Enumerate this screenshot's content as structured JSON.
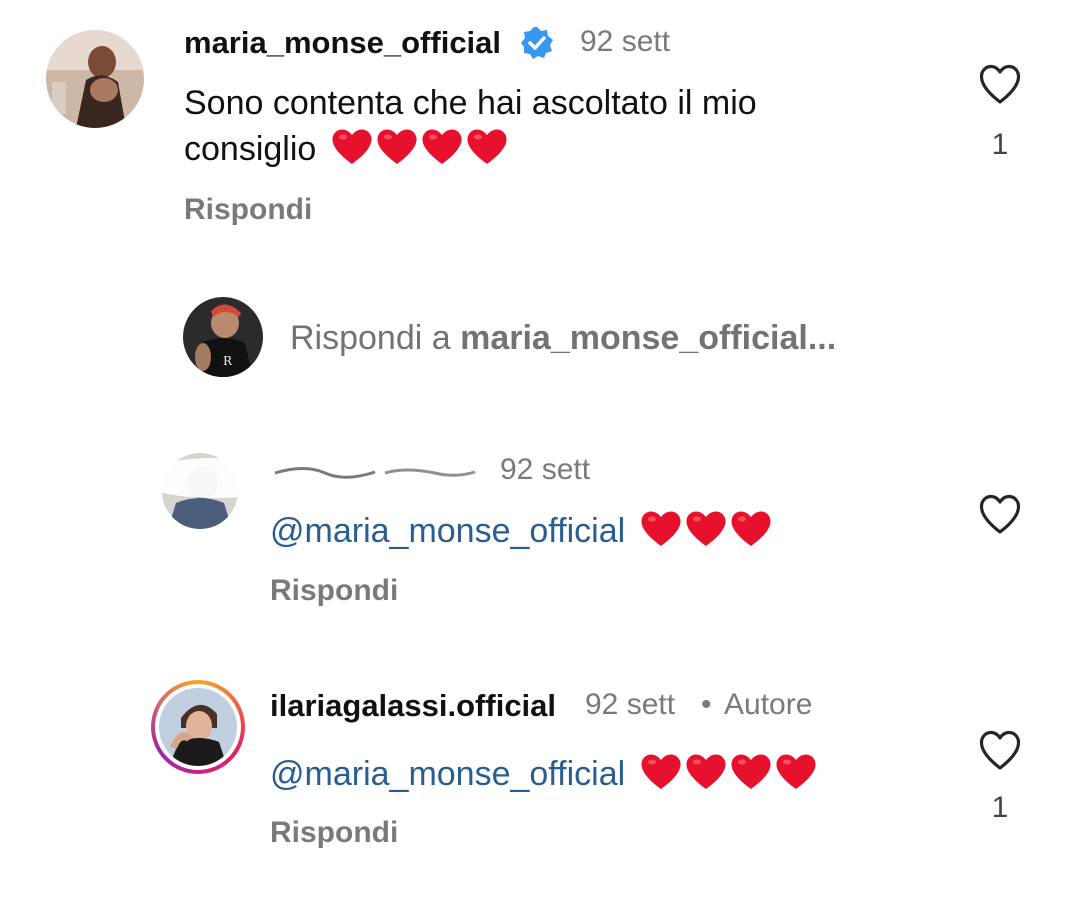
{
  "comments": [
    {
      "username": "maria_monse_official",
      "verified": true,
      "time": "92 sett",
      "text_line1": "Sono contenta che hai ascoltato il mio",
      "text_line2": "consiglio",
      "heart_count": 4,
      "reply_label": "Rispondi",
      "likes": "1"
    },
    {
      "username": "",
      "time": "92 sett",
      "mention": "@maria_monse_official",
      "heart_count": 3,
      "reply_label": "Rispondi"
    },
    {
      "username": "ilariagalassi.official",
      "time": "92 sett",
      "separator": "•",
      "author_badge": "Autore",
      "mention": "@maria_monse_official",
      "heart_count": 4,
      "reply_label": "Rispondi",
      "likes": "1"
    }
  ],
  "reply_box": {
    "prefix": "Rispondi a ",
    "target": "maria_monse_official..."
  },
  "colors": {
    "verified": "#3897f0",
    "mention": "#2a5d90",
    "heart": "#e8112d",
    "muted_text": "#7a7a7a"
  }
}
